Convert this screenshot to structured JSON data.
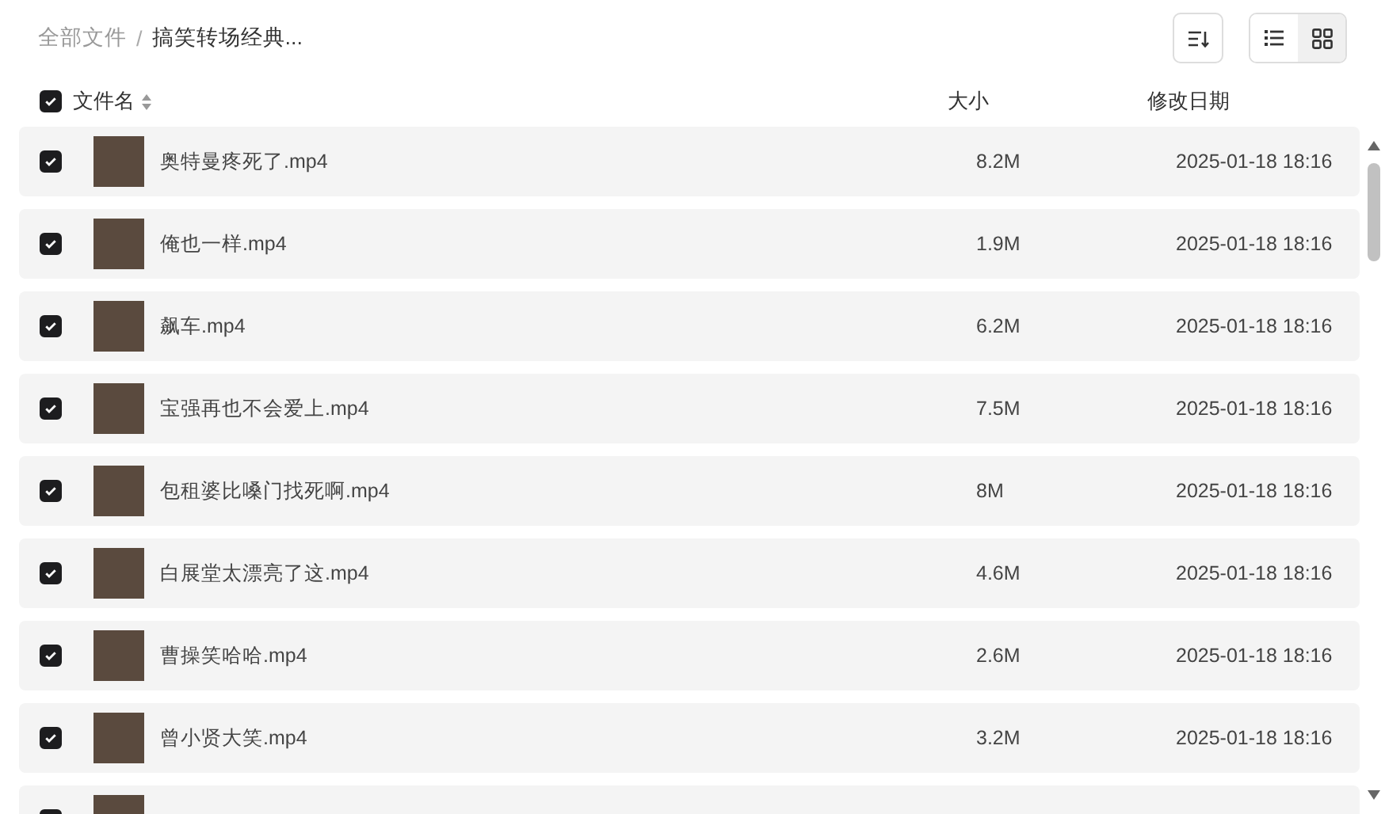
{
  "breadcrumb_separator": "/",
  "breadcrumb": [
    {
      "label": "全部文件",
      "current": false
    },
    {
      "label": "搞笑转场经典...",
      "current": true
    }
  ],
  "view_modes": [
    {
      "kind": "list",
      "selected": false
    },
    {
      "kind": "grid",
      "selected": true
    }
  ],
  "table": {
    "select_all": {
      "checked": true
    },
    "columns": [
      "文件名",
      "大小",
      "修改日期"
    ],
    "rows": [
      {
        "checked": true,
        "name": "奥特曼疼死了.mp4",
        "size": "8.2M",
        "modified": "2025-01-18 18:16"
      },
      {
        "checked": true,
        "name": "俺也一样.mp4",
        "size": "1.9M",
        "modified": "2025-01-18 18:16"
      },
      {
        "checked": true,
        "name": "飙车.mp4",
        "size": "6.2M",
        "modified": "2025-01-18 18:16"
      },
      {
        "checked": true,
        "name": "宝强再也不会爱上.mp4",
        "size": "7.5M",
        "modified": "2025-01-18 18:16"
      },
      {
        "checked": true,
        "name": "包租婆比嗓门找死啊.mp4",
        "size": "8M",
        "modified": "2025-01-18 18:16"
      },
      {
        "checked": true,
        "name": "白展堂太漂亮了这.mp4",
        "size": "4.6M",
        "modified": "2025-01-18 18:16"
      },
      {
        "checked": true,
        "name": "曹操笑哈哈.mp4",
        "size": "2.6M",
        "modified": "2025-01-18 18:16"
      },
      {
        "checked": true,
        "name": "曾小贤大笑.mp4",
        "size": "3.2M",
        "modified": "2025-01-18 18:16"
      },
      {
        "checked": true
      }
    ]
  }
}
